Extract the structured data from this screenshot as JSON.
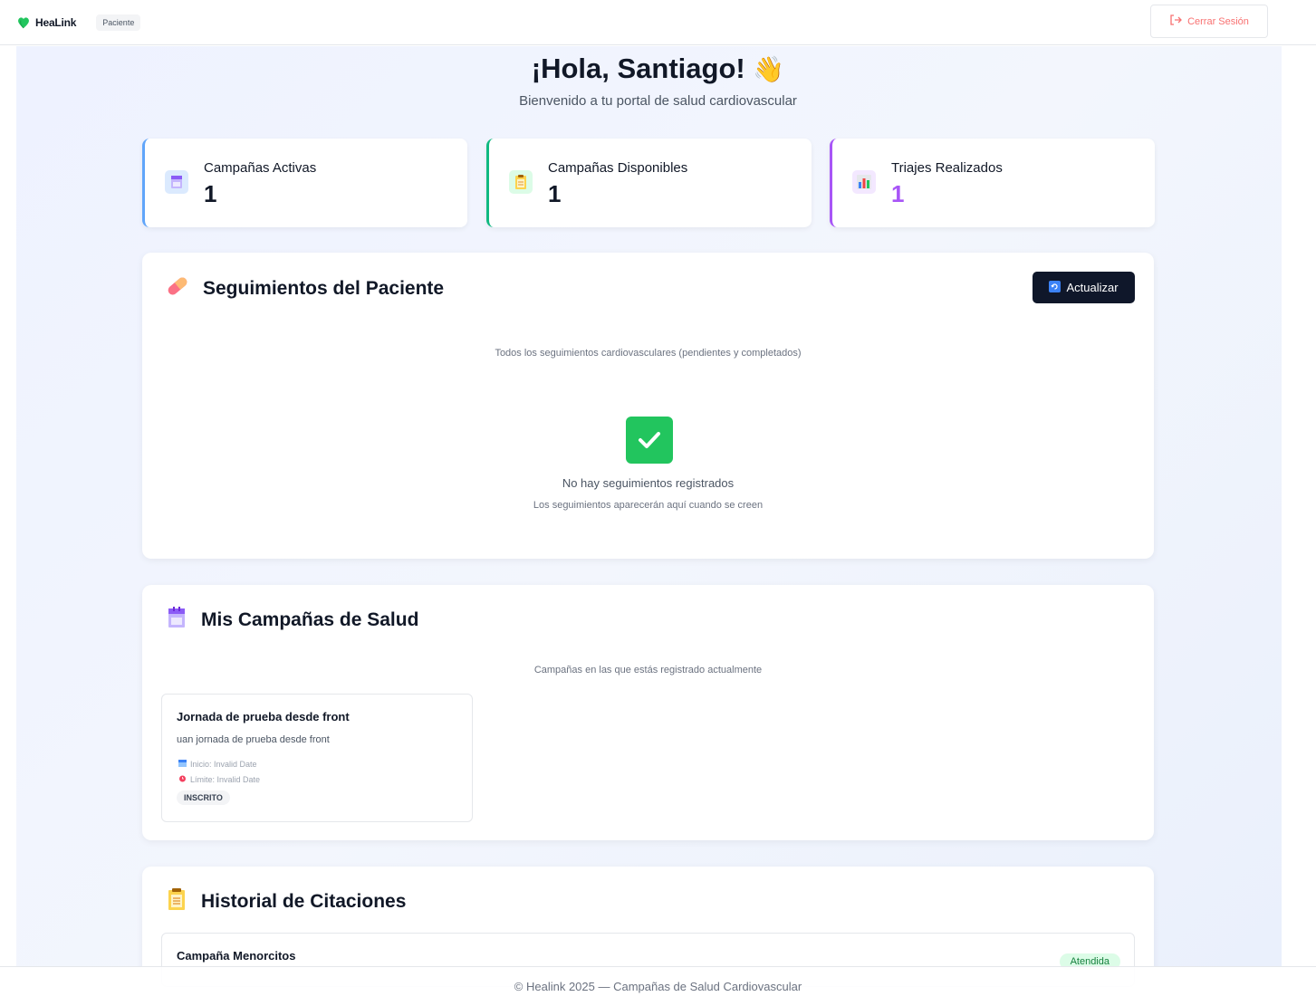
{
  "header": {
    "brand": "HeaLink",
    "role": "Paciente",
    "logout_label": "Cerrar Sesión"
  },
  "hero": {
    "greeting": "¡Hola, Santiago!",
    "wave": "👋",
    "subtitle": "Bienvenido a tu portal de salud cardiovascular"
  },
  "stats": [
    {
      "label": "Campañas Activas",
      "value": "1",
      "accent": "#60a5fa",
      "icon": "calendar-icon"
    },
    {
      "label": "Campañas Disponibles",
      "value": "1",
      "accent": "#10b981",
      "icon": "clipboard-icon"
    },
    {
      "label": "Triajes Realizados",
      "value": "1",
      "accent": "#a855f7",
      "icon": "chart-icon"
    }
  ],
  "followups": {
    "title": "Seguimientos del Paciente",
    "refresh_label": "Actualizar",
    "description": "Todos los seguimientos cardiovasculares (pendientes y completados)",
    "empty_title": "No hay seguimientos registrados",
    "empty_sub": "Los seguimientos aparecerán aquí cuando se creen"
  },
  "campaigns": {
    "title": "Mis Campañas de Salud",
    "description": "Campañas en las que estás registrado actualmente",
    "items": [
      {
        "name": "Jornada de prueba desde front",
        "desc": "uan jornada de prueba desde front",
        "start": "Inicio: Invalid Date",
        "limit": "Límite: Invalid Date",
        "badge": "INSCRITO"
      }
    ]
  },
  "citations": {
    "title": "Historial de Citaciones",
    "items": [
      {
        "name": "Campaña Menorcitos",
        "status": "Atendida"
      }
    ]
  },
  "footer": {
    "text": "© Healink 2025 — Campañas de Salud Cardiovascular"
  }
}
